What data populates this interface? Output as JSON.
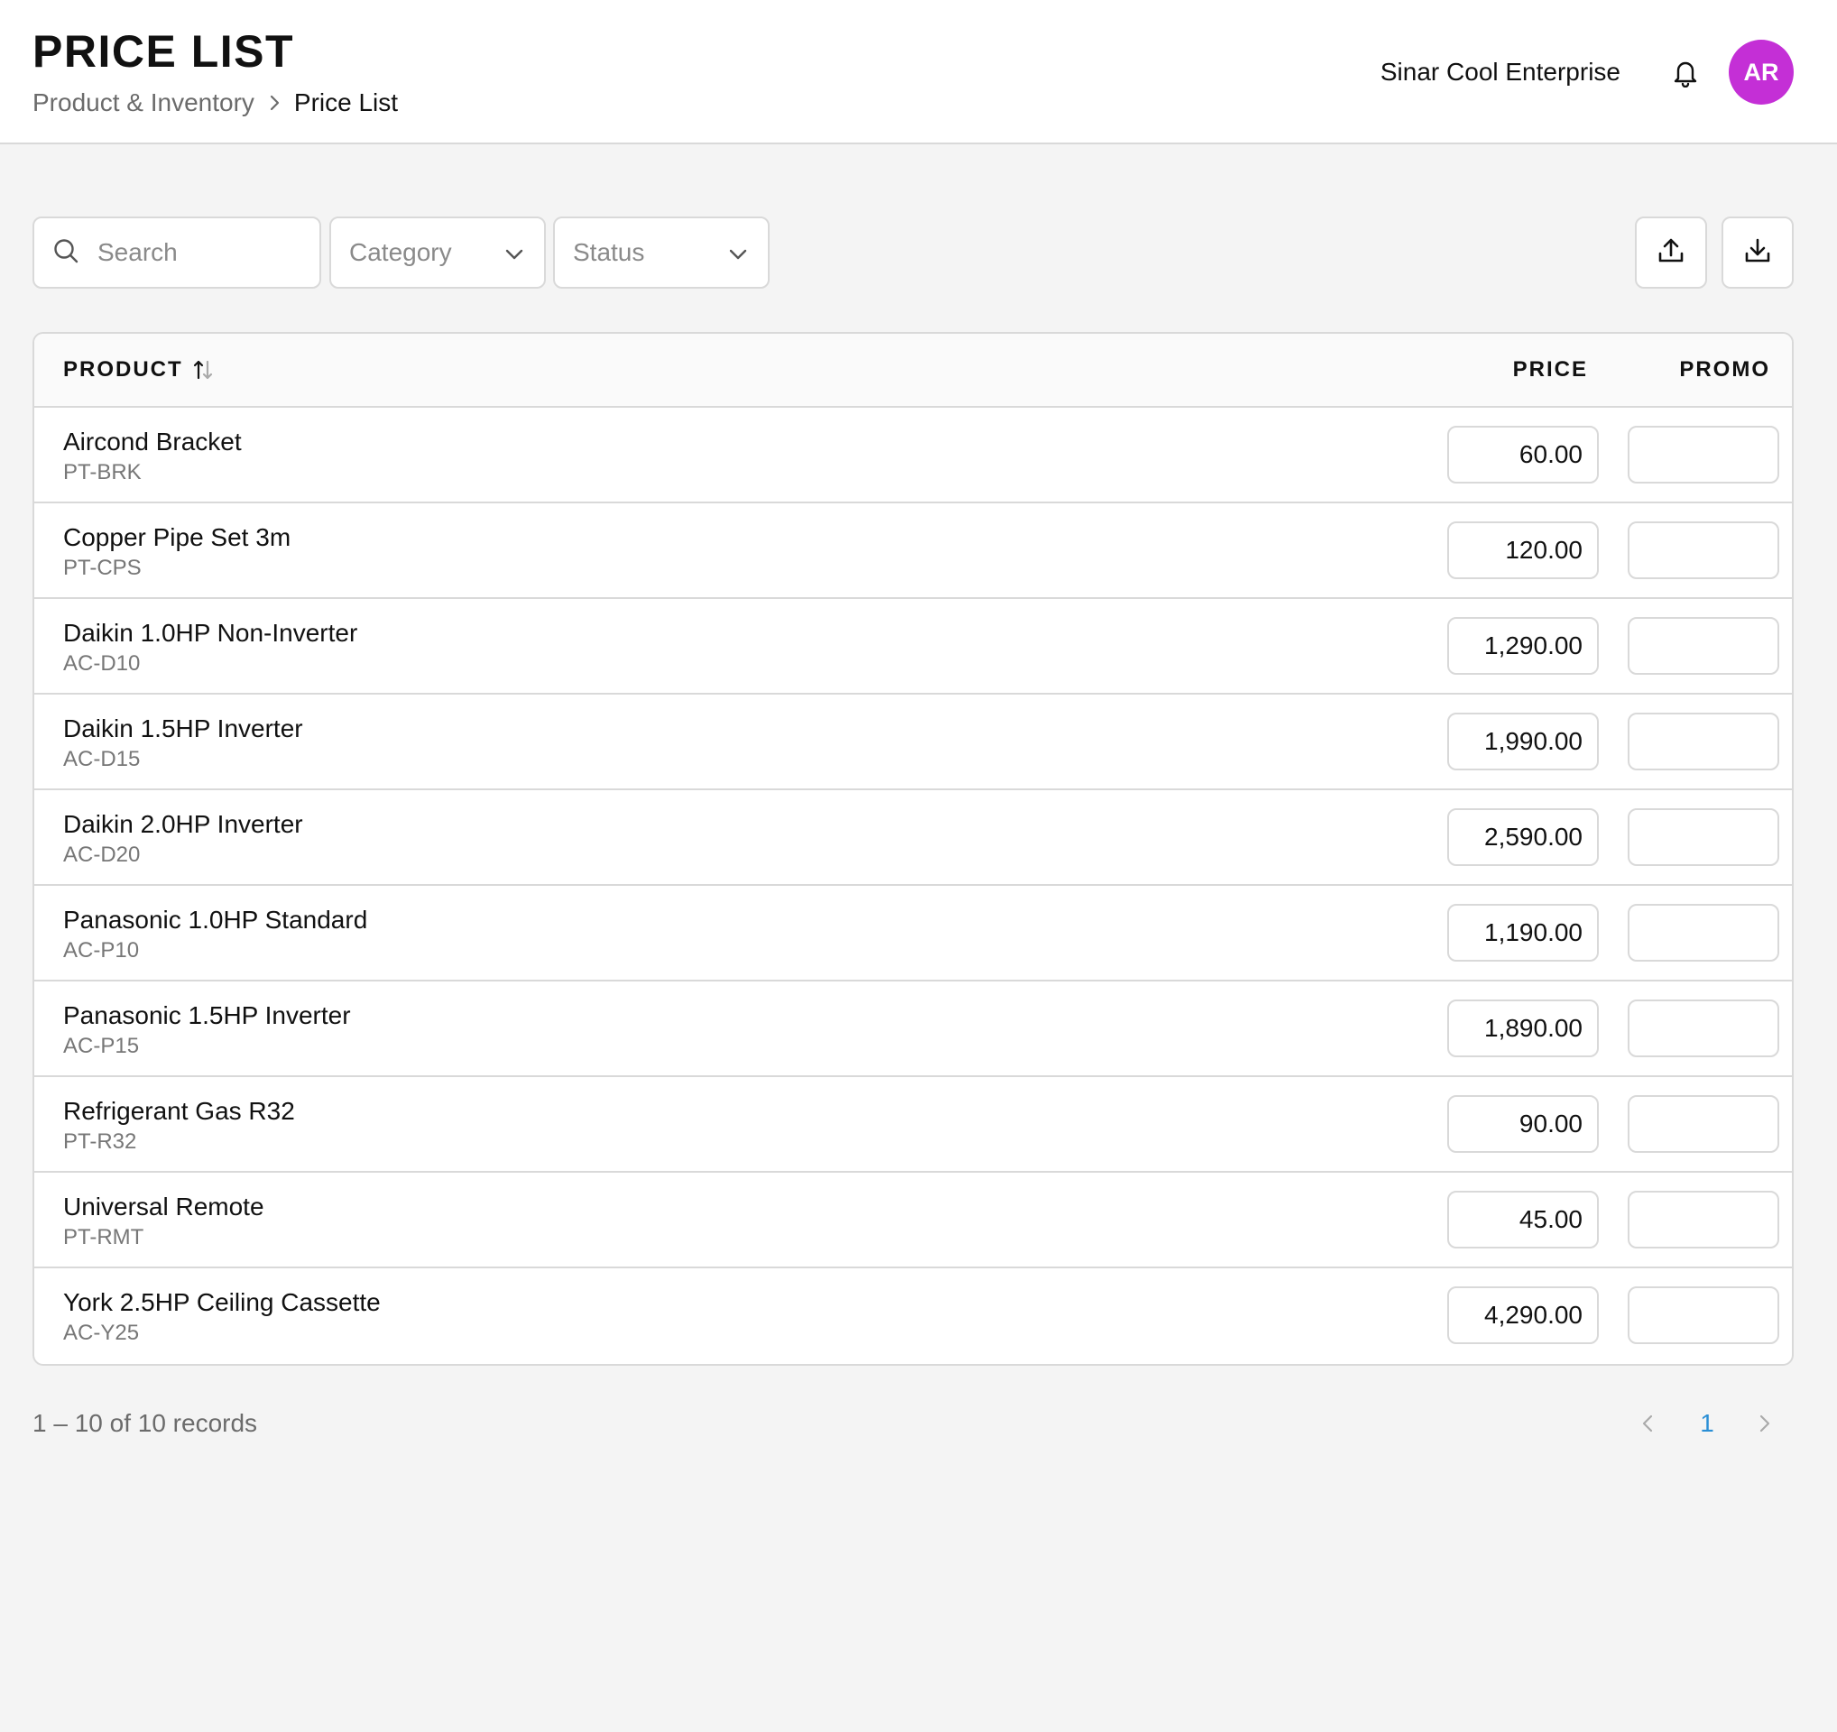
{
  "header": {
    "title": "PRICE LIST",
    "breadcrumb": {
      "parent": "Product & Inventory",
      "current": "Price List"
    },
    "organization": "Sinar Cool Enterprise",
    "avatar_initials": "AR",
    "avatar_color": "#c42fd6",
    "icons": {
      "notifications": "bell-icon",
      "separator": "chevron-right-icon"
    }
  },
  "toolbar": {
    "search_placeholder": "Search",
    "category_placeholder": "Category",
    "status_placeholder": "Status",
    "icons": {
      "search": "search-icon",
      "dropdown": "chevron-down-icon",
      "upload": "upload-icon",
      "download": "download-icon"
    }
  },
  "table": {
    "columns": {
      "product": "PRODUCT",
      "price": "PRICE",
      "promo": "PROMO"
    },
    "sort_icon": "sort-arrows-icon",
    "rows": [
      {
        "name": "Aircond Bracket",
        "code": "PT-BRK",
        "price": "60.00",
        "promo": ""
      },
      {
        "name": "Copper Pipe Set 3m",
        "code": "PT-CPS",
        "price": "120.00",
        "promo": ""
      },
      {
        "name": "Daikin 1.0HP Non-Inverter",
        "code": "AC-D10",
        "price": "1,290.00",
        "promo": ""
      },
      {
        "name": "Daikin 1.5HP Inverter",
        "code": "AC-D15",
        "price": "1,990.00",
        "promo": ""
      },
      {
        "name": "Daikin 2.0HP Inverter",
        "code": "AC-D20",
        "price": "2,590.00",
        "promo": ""
      },
      {
        "name": "Panasonic 1.0HP Standard",
        "code": "AC-P10",
        "price": "1,190.00",
        "promo": ""
      },
      {
        "name": "Panasonic 1.5HP Inverter",
        "code": "AC-P15",
        "price": "1,890.00",
        "promo": ""
      },
      {
        "name": "Refrigerant Gas R32",
        "code": "PT-R32",
        "price": "90.00",
        "promo": ""
      },
      {
        "name": "Universal Remote",
        "code": "PT-RMT",
        "price": "45.00",
        "promo": ""
      },
      {
        "name": "York 2.5HP Ceiling Cassette",
        "code": "AC-Y25",
        "price": "4,290.00",
        "promo": ""
      }
    ]
  },
  "footer": {
    "records_text": "1 – 10 of 10 records",
    "current_page": "1",
    "page_color": "#2a8fd6",
    "icons": {
      "prev": "chevron-left-icon",
      "next": "chevron-right-icon"
    }
  }
}
